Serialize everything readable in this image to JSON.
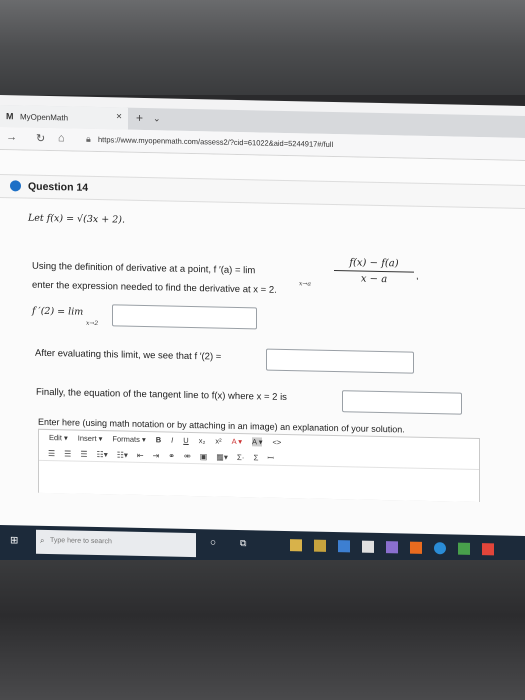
{
  "browser": {
    "tab_logo": "M",
    "tab_title": "MyOpenMath",
    "tab_close": "×",
    "new_tab": "+",
    "tab_menu": "⌄",
    "url": "https://www.myopenmath.com/assess2/?cid=61022&aid=5244917#/full"
  },
  "question": {
    "title": "Question 14",
    "function_def": "Let f(x) = √(3x + 2).",
    "definition_text": "Using the definition of derivative at a point, f ′(a) = lim",
    "definition_lim_sub": "x→a",
    "fraction_num": "f(x) − f(a)",
    "fraction_den": "x − a",
    "fraction_comma": ",",
    "instruction": "enter the expression needed to find the derivative at x = 2.",
    "limit_label": "f ′(2) = lim",
    "limit_sub": "x→2",
    "evaluating_text": "After evaluating this limit, we see that f ′(2) =",
    "tangent_text": "Finally, the equation of the tangent line to f(x) where x = 2 is",
    "explain_text": "Enter here (using math notation or by attaching in an image) an explanation of your solution."
  },
  "editor": {
    "menu": [
      "Edit ▾",
      "Insert ▾",
      "Formats ▾"
    ],
    "bold": "B",
    "italic": "I",
    "underline": "U",
    "subscript": "x₂",
    "superscript": "x²",
    "font_color": "A ▾",
    "bg_color": "A ▾",
    "code": "<>",
    "sum1": "Σ·",
    "sum2": "Σ",
    "math": "ꟷ"
  },
  "taskbar": {
    "search_placeholder": "Type here to search"
  },
  "colors": {
    "accent": "#1e70c6",
    "taskbar": "#1c2a3a"
  }
}
